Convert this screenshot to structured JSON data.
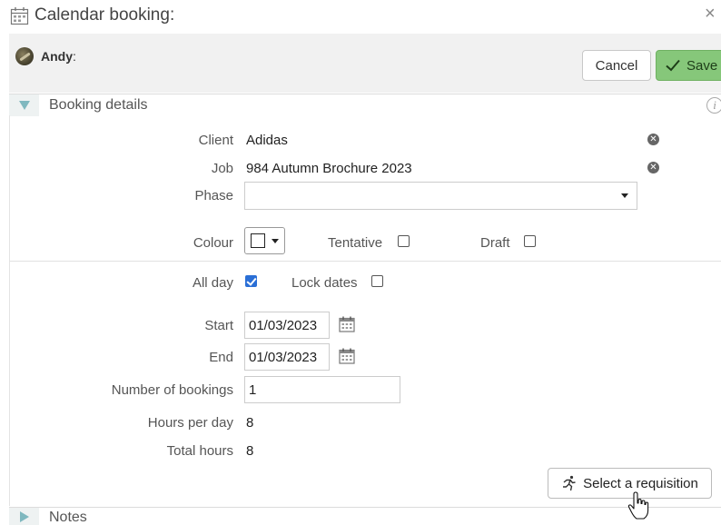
{
  "window": {
    "title": "Calendar booking:",
    "close_glyph": "×",
    "title_icon": "calendar-icon"
  },
  "user": {
    "name": "Andy",
    "colon": ":"
  },
  "actions": {
    "cancel_label": "Cancel",
    "save_label": "Save",
    "save_color": "#86c77a"
  },
  "sections": {
    "booking_details": "Booking details",
    "notes": "Notes",
    "info_glyph": "i"
  },
  "fields": {
    "client_label": "Client",
    "client_value": "Adidas",
    "job_label": "Job",
    "job_value": "984 Autumn Brochure 2023",
    "phase_label": "Phase",
    "phase_value": "",
    "colour_label": "Colour",
    "tentative_label": "Tentative",
    "tentative_checked": false,
    "draft_label": "Draft",
    "draft_checked": false,
    "all_day_label": "All day",
    "all_day_checked": true,
    "lock_dates_label": "Lock dates",
    "lock_dates_checked": false,
    "start_label": "Start",
    "start_value": "01/03/2023",
    "end_label": "End",
    "end_value": "01/03/2023",
    "num_bookings_label": "Number of bookings",
    "num_bookings_value": "1",
    "hours_per_day_label": "Hours per day",
    "hours_per_day_value": "8",
    "total_hours_label": "Total hours",
    "total_hours_value": "8"
  },
  "requisition": {
    "button_label": "Select a requisition",
    "icon": "runner-icon"
  },
  "colors": {
    "accent_check": "#2a6fd6",
    "section_toggle": "#7fb8bf"
  }
}
